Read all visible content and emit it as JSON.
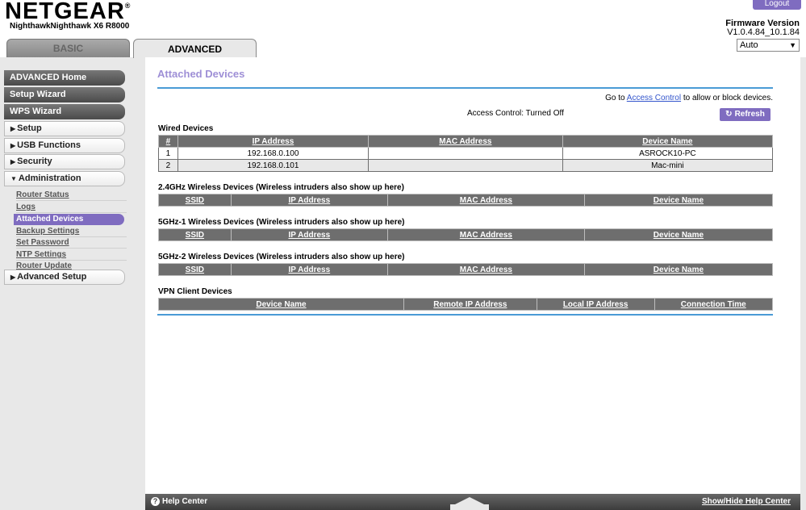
{
  "header": {
    "brand": "NETGEAR",
    "brand_mark": "®",
    "model": "NighthawkNighthawk X6 R8000",
    "logout_label": "Logout",
    "firmware_title": "Firmware Version",
    "firmware_version": "V1.0.4.84_10.1.84",
    "language_selected": "Auto",
    "tabs": [
      {
        "label": "BASIC"
      },
      {
        "label": "ADVANCED"
      }
    ]
  },
  "sidebar": {
    "primary": [
      {
        "label": "ADVANCED Home"
      },
      {
        "label": "Setup Wizard"
      },
      {
        "label": "WPS Wizard"
      }
    ],
    "groups": [
      {
        "label": "Setup"
      },
      {
        "label": "USB Functions"
      },
      {
        "label": "Security"
      },
      {
        "label": "Administration"
      },
      {
        "label": "Advanced Setup"
      }
    ],
    "admin_items": [
      {
        "label": "Router Status"
      },
      {
        "label": "Logs"
      },
      {
        "label": "Attached Devices"
      },
      {
        "label": "Backup Settings"
      },
      {
        "label": "Set Password"
      },
      {
        "label": "NTP Settings"
      },
      {
        "label": "Router Update"
      }
    ]
  },
  "main": {
    "title": "Attached Devices",
    "goto_prefix": "Go to",
    "goto_link": "Access Control",
    "goto_suffix": "to allow or block devices.",
    "access_control_status": "Access Control: Turned Off",
    "refresh_label": "Refresh",
    "wired": {
      "title": "Wired Devices",
      "headers": [
        "#",
        "IP Address",
        "MAC Address",
        "Device Name"
      ],
      "rows": [
        {
          "num": "1",
          "ip": "192.168.0.100",
          "mac": "",
          "name": "ASROCK10-PC"
        },
        {
          "num": "2",
          "ip": "192.168.0.101",
          "mac": "",
          "name": "Mac-mini"
        }
      ]
    },
    "wireless_24": {
      "title": "2.4GHz Wireless Devices (Wireless intruders also show up here)",
      "headers": [
        "SSID",
        "IP Address",
        "MAC Address",
        "Device Name"
      ]
    },
    "wireless_5_1": {
      "title": "5GHz-1 Wireless Devices (Wireless intruders also show up here)",
      "headers": [
        "SSID",
        "IP Address",
        "MAC Address",
        "Device Name"
      ]
    },
    "wireless_5_2": {
      "title": "5GHz-2 Wireless Devices (Wireless intruders also show up here)",
      "headers": [
        "SSID",
        "IP Address",
        "MAC Address",
        "Device Name"
      ]
    },
    "vpn": {
      "title": "VPN Client Devices",
      "headers": [
        "Device Name",
        "Remote IP Address",
        "Local IP Address",
        "Connection Time"
      ]
    }
  },
  "footer": {
    "help_label": "Help Center",
    "help_icon": "?",
    "show_hide_label": "Show/Hide Help Center"
  },
  "colors": {
    "accent_purple": "#7f6cc0",
    "title_purple": "#9e8fd6",
    "rule_blue": "#4a9bd6",
    "header_gray": "#6e6e6e"
  }
}
